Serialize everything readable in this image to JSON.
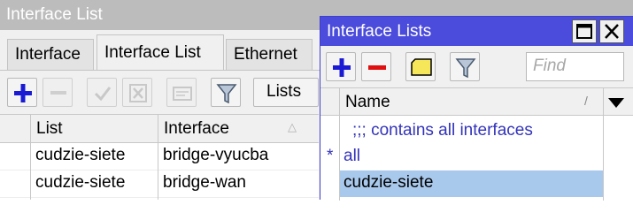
{
  "back_window": {
    "title": "Interface List",
    "tabs": [
      {
        "label": "Interface",
        "active": false
      },
      {
        "label": "Interface List",
        "active": true
      },
      {
        "label": "Ethernet",
        "active": false
      }
    ],
    "toolbar": {
      "lists_label": "Lists"
    },
    "table": {
      "columns": [
        "List",
        "Interface"
      ],
      "rows": [
        {
          "list": "cudzie-siete",
          "interface": "bridge-vyucba"
        },
        {
          "list": "cudzie-siete",
          "interface": "bridge-wan"
        }
      ]
    }
  },
  "front_window": {
    "title": "Interface Lists",
    "find_placeholder": "Find",
    "column_name": "Name",
    "rows": [
      {
        "marker": "",
        "text": ";;; contains all interfaces",
        "type": "comment"
      },
      {
        "marker": "*",
        "text": "all",
        "type": "builtin"
      },
      {
        "marker": "",
        "text": "cudzie-siete",
        "type": "selected"
      }
    ]
  },
  "colors": {
    "front_titlebar": "#4b4bdc",
    "back_titlebar": "#bcbcbc",
    "add_icon": "#1a1ad4",
    "remove_icon": "#e01010",
    "comment_text": "#3333bb",
    "selected_row": "#a8c8ec"
  },
  "icons": [
    "plus-icon",
    "minus-icon",
    "check-icon",
    "cross-icon",
    "comment-icon",
    "filter-icon",
    "restore-icon",
    "close-icon",
    "sort-icon",
    "dropdown-icon"
  ]
}
